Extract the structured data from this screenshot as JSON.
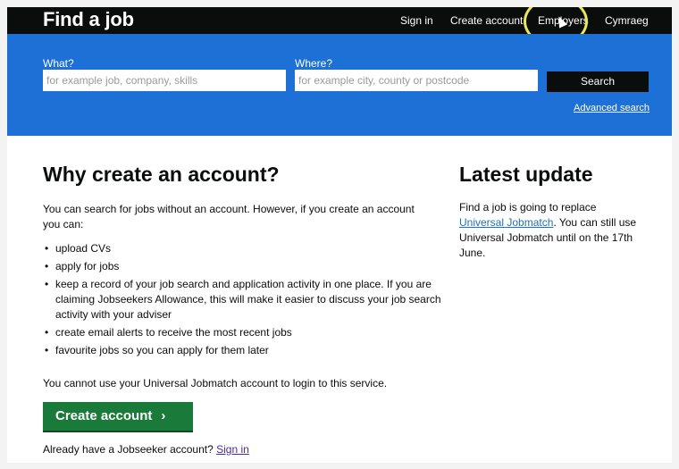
{
  "header": {
    "brand": "Find a job",
    "nav": {
      "sign_in": "Sign in",
      "create_account": "Create account",
      "employers": "Employers",
      "cymraeg": "Cymraeg"
    }
  },
  "search": {
    "what_label": "What?",
    "what_placeholder": "for example job, company, skills",
    "where_label": "Where?",
    "where_placeholder": "for example city, county or postcode",
    "button": "Search",
    "advanced": "Advanced search"
  },
  "main": {
    "heading": "Why create an account?",
    "intro": "You can search for jobs without an account. However, if you create an account you can:",
    "benefits": [
      "upload CVs",
      "apply for jobs",
      "keep a record of your job search and application activity in one place. If you are claiming Jobseekers Allowance, this will make it easier to discuss your job search activity with your adviser",
      "create email alerts to receive the most recent jobs",
      "favourite jobs so you can apply for them later"
    ],
    "no_login": "You cannot use your Universal Jobmatch account to login to this service.",
    "create_button": "Create account",
    "create_chevron": "›",
    "already_text": "Already have a Jobseeker account?",
    "already_link": "Sign in"
  },
  "sidebar": {
    "heading": "Latest update",
    "text_before": "Find a job is going to replace",
    "link": "Universal Jobmatch",
    "text_after": ". You can still use Universal Jobmatch until on the 17th June."
  },
  "colors": {
    "header_bg": "#0b0c0c",
    "search_bg": "#1d70d6",
    "button_green": "#1a7a3a",
    "link_blue": "#1d70b8"
  }
}
